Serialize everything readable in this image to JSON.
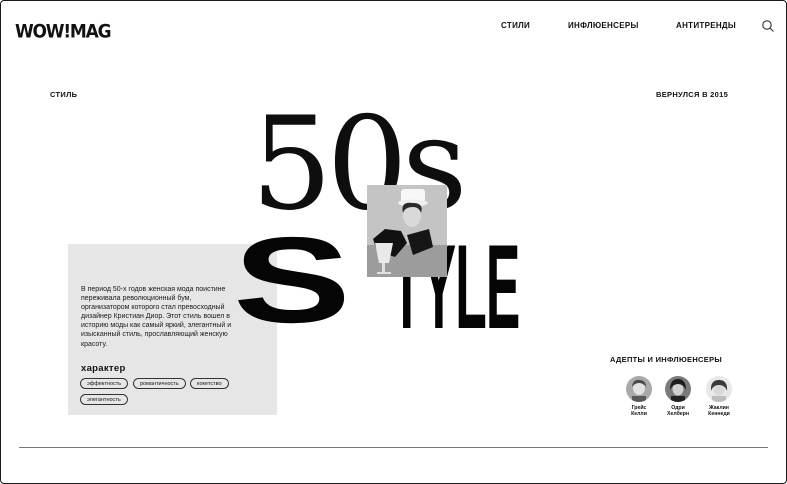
{
  "header": {
    "logo": "WOW!MAG",
    "nav": [
      {
        "label": "СТИЛИ"
      },
      {
        "label": "ИНФЛЮЕНСЕРЫ"
      },
      {
        "label": "АНТИТРЕНДЫ"
      }
    ],
    "search_icon": "search-icon"
  },
  "meta": {
    "category": "СТИЛЬ",
    "returned": "ВЕРНУЛСЯ В 2015"
  },
  "hero": {
    "number": "50s",
    "word_first": "S",
    "word_rest": "TYLE",
    "photo_icon": "portrait-photo"
  },
  "panel": {
    "description": "В период 50-х годов женская мода поистине переживала революционный бум, организатором которого стал превосходный дизайнер Кристиан Диор. Этот стиль вошел в историю моды как самый яркий, элегантный и изысканный стиль, прославляющий женскую красоту.",
    "character_title": "характер",
    "tags": [
      "эффектность",
      "романтичность",
      "кокетство",
      "элегантность"
    ]
  },
  "adepts": {
    "title": "АДЕПТЫ И ИНФЛЮЕНСЕРЫ",
    "people": [
      {
        "name": "Грейс\nКелли"
      },
      {
        "name": "Одри\nХелберн"
      },
      {
        "name": "Жаклин\nКеннеди"
      }
    ]
  },
  "colors": {
    "background": "#ffffff",
    "panel": "#e6e6e6",
    "text": "#111111"
  }
}
